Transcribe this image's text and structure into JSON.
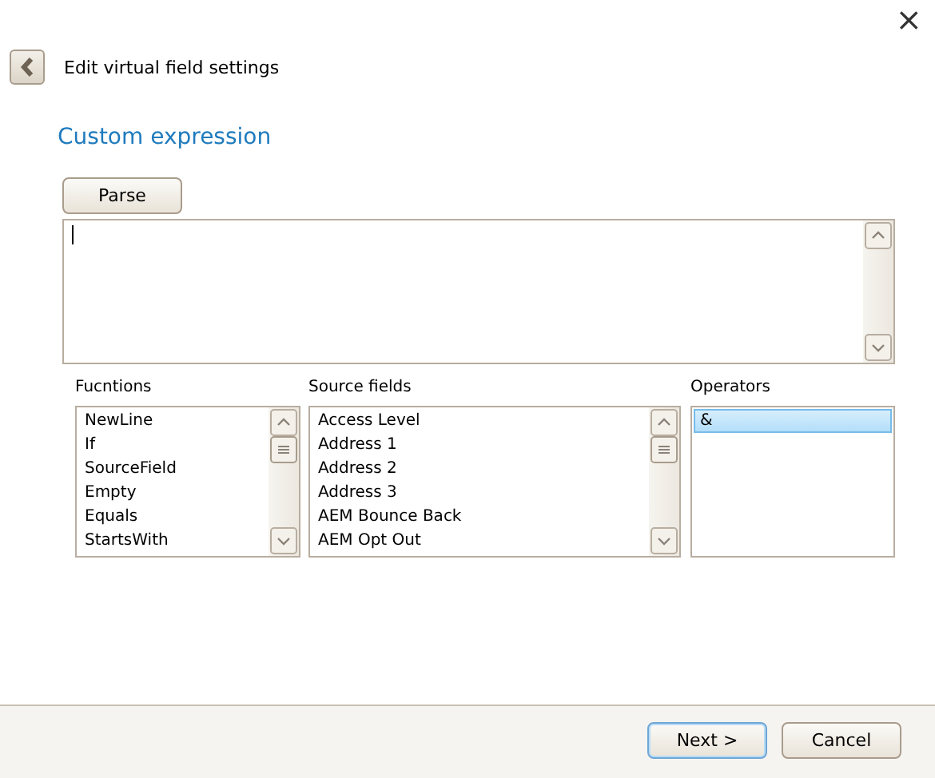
{
  "window": {
    "close": "×",
    "title": "Edit virtual field settings"
  },
  "section": {
    "heading": "Custom expression",
    "parse_button": "Parse"
  },
  "lists": [
    {
      "label": "Fucntions",
      "scrollable": true,
      "items": [
        {
          "text": "NewLine",
          "selected": false
        },
        {
          "text": "If",
          "selected": false
        },
        {
          "text": "SourceField",
          "selected": false
        },
        {
          "text": "Empty",
          "selected": false
        },
        {
          "text": "Equals",
          "selected": false
        },
        {
          "text": "StartsWith",
          "selected": false
        }
      ]
    },
    {
      "label": "Source fields",
      "scrollable": true,
      "items": [
        {
          "text": "Access Level",
          "selected": false
        },
        {
          "text": "Address 1",
          "selected": false
        },
        {
          "text": "Address 2",
          "selected": false
        },
        {
          "text": "Address 3",
          "selected": false
        },
        {
          "text": "AEM Bounce Back",
          "selected": false
        },
        {
          "text": "AEM Opt Out",
          "selected": false
        }
      ]
    },
    {
      "label": "Operators",
      "scrollable": false,
      "items": [
        {
          "text": "&",
          "selected": true
        }
      ]
    }
  ],
  "buttons": [
    {
      "label": "Next >",
      "default": true
    },
    {
      "label": "Cancel",
      "default": false
    }
  ]
}
